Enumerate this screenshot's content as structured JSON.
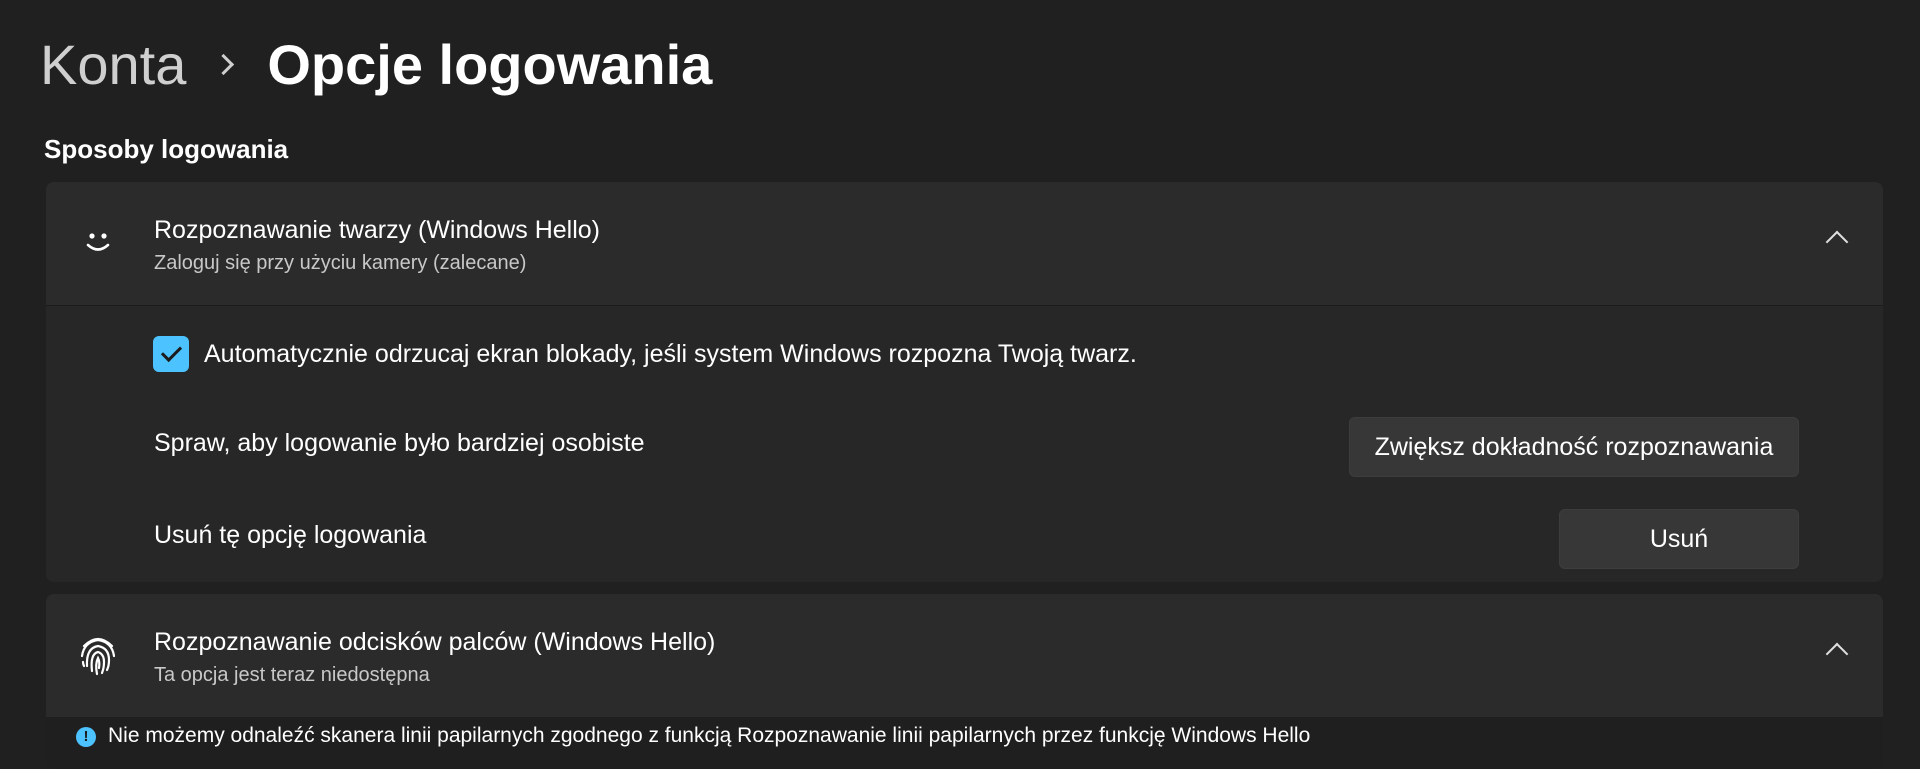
{
  "breadcrumb": {
    "parent": "Konta",
    "current": "Opcje logowania"
  },
  "section": {
    "title": "Sposoby logowania"
  },
  "face": {
    "icon": "smiley-face-icon",
    "title": "Rozpoznawanie twarzy (Windows Hello)",
    "subtitle": "Zaloguj się przy użyciu kamery (zalecane)",
    "expanded": true,
    "auto_dismiss": {
      "checked": true,
      "label": "Automatycznie odrzucaj ekran blokady, jeśli system Windows rozpozna Twoją twarz."
    },
    "improve": {
      "label": "Spraw, aby logowanie było bardziej osobiste",
      "button": "Zwiększ dokładność rozpoznawania"
    },
    "remove": {
      "label": "Usuń tę opcję logowania",
      "button": "Usuń"
    }
  },
  "fingerprint": {
    "icon": "fingerprint-icon",
    "title": "Rozpoznawanie odcisków palców (Windows Hello)",
    "subtitle": "Ta opcja jest teraz niedostępna",
    "expanded": true,
    "info": "Nie możemy odnaleźć skanera linii papilarnych zgodnego z funkcją Rozpoznawanie linii papilarnych przez funkcję Windows Hello"
  },
  "colors": {
    "background": "#202020",
    "card": "#2b2b2b",
    "accent": "#4cc2ff"
  }
}
